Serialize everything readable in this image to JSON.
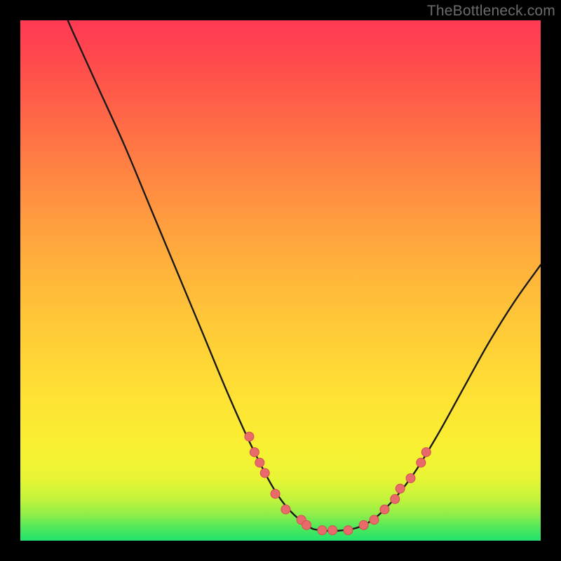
{
  "watermark": "TheBottleneck.com",
  "colors": {
    "background": "#000000",
    "curve_stroke": "#1a1a1a",
    "marker_fill": "#e86a6a",
    "marker_stroke": "#d44f4f"
  },
  "chart_data": {
    "type": "line",
    "title": "",
    "xlabel": "",
    "ylabel": "",
    "xlim": [
      0,
      100
    ],
    "ylim": [
      0,
      100
    ],
    "grid": false,
    "legend": false,
    "curve": [
      {
        "x": 7,
        "y": 105
      },
      {
        "x": 10,
        "y": 98
      },
      {
        "x": 15,
        "y": 87
      },
      {
        "x": 20,
        "y": 76
      },
      {
        "x": 25,
        "y": 64
      },
      {
        "x": 30,
        "y": 52
      },
      {
        "x": 35,
        "y": 40
      },
      {
        "x": 40,
        "y": 28
      },
      {
        "x": 45,
        "y": 17
      },
      {
        "x": 50,
        "y": 8
      },
      {
        "x": 55,
        "y": 3
      },
      {
        "x": 58,
        "y": 2
      },
      {
        "x": 62,
        "y": 2
      },
      {
        "x": 66,
        "y": 3
      },
      {
        "x": 70,
        "y": 6
      },
      {
        "x": 75,
        "y": 12
      },
      {
        "x": 80,
        "y": 20
      },
      {
        "x": 85,
        "y": 29
      },
      {
        "x": 90,
        "y": 38
      },
      {
        "x": 95,
        "y": 46
      },
      {
        "x": 100,
        "y": 53
      }
    ],
    "markers": [
      {
        "x": 44,
        "y": 20
      },
      {
        "x": 45,
        "y": 17
      },
      {
        "x": 46,
        "y": 15
      },
      {
        "x": 47,
        "y": 13
      },
      {
        "x": 49,
        "y": 9
      },
      {
        "x": 51,
        "y": 6
      },
      {
        "x": 54,
        "y": 4
      },
      {
        "x": 55,
        "y": 3
      },
      {
        "x": 58,
        "y": 2
      },
      {
        "x": 60,
        "y": 2
      },
      {
        "x": 63,
        "y": 2
      },
      {
        "x": 66,
        "y": 3
      },
      {
        "x": 68,
        "y": 4
      },
      {
        "x": 70,
        "y": 6
      },
      {
        "x": 72,
        "y": 8
      },
      {
        "x": 73,
        "y": 10
      },
      {
        "x": 75,
        "y": 12
      },
      {
        "x": 77,
        "y": 15
      },
      {
        "x": 78,
        "y": 17
      }
    ]
  }
}
